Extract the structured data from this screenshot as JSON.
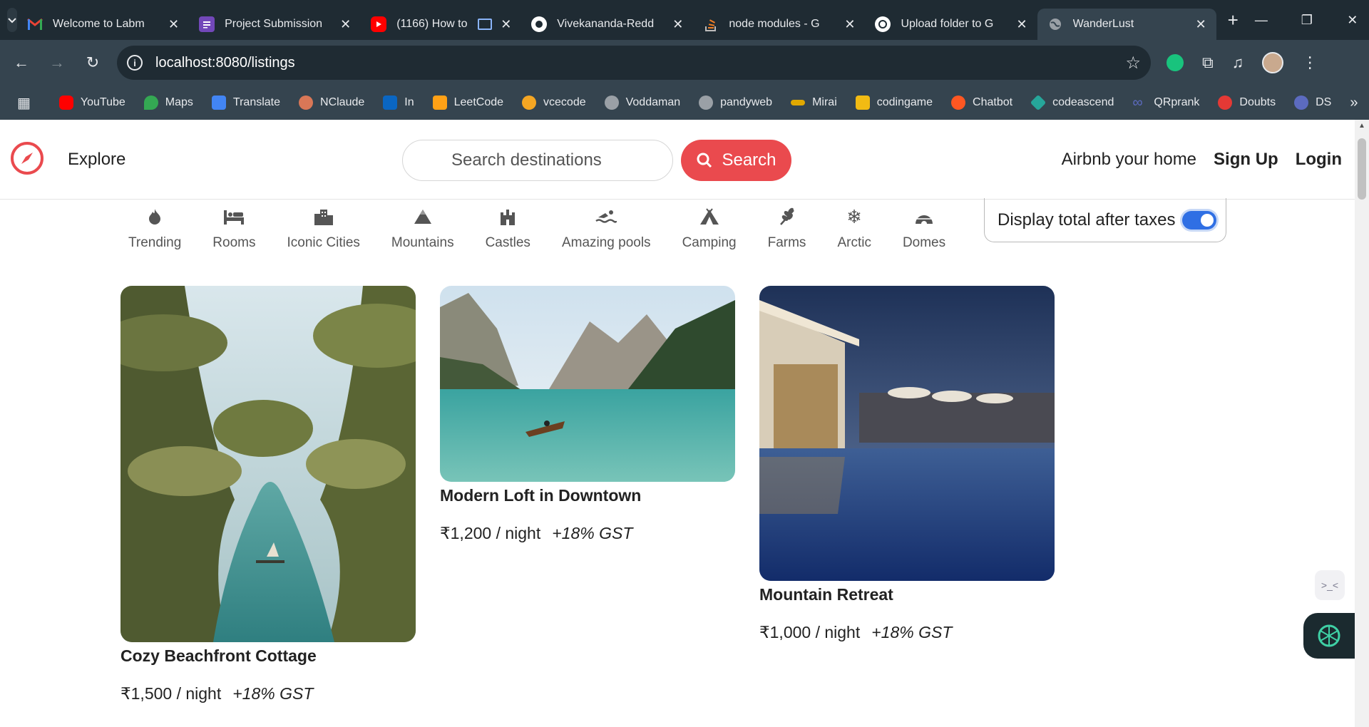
{
  "browser": {
    "tabs": [
      {
        "title": "Welcome to Labm",
        "favicon": "gmail-icon",
        "color": "#ea4335"
      },
      {
        "title": "Project Submission",
        "favicon": "forms-icon",
        "color": "#7248b9"
      },
      {
        "title": "(1166) How to",
        "favicon": "youtube-icon",
        "color": "#ff0000"
      },
      {
        "title": "Vivekananda-Redd",
        "favicon": "github-icon",
        "color": "#ffffff"
      },
      {
        "title": "node modules - G",
        "favicon": "stackoverflow-icon",
        "color": "#f48024"
      },
      {
        "title": "Upload folder to G",
        "favicon": "chatgpt-icon",
        "color": "#ffffff"
      },
      {
        "title": "WanderLust",
        "favicon": "globe-icon",
        "color": "#9aa0a6"
      }
    ],
    "url": "localhost:8080/listings",
    "bookmarks": [
      {
        "label": "YouTube",
        "color": "#ff0000"
      },
      {
        "label": "Maps",
        "color": "#34a853"
      },
      {
        "label": "Translate",
        "color": "#4285f4"
      },
      {
        "label": "NClaude",
        "color": "#d97757"
      },
      {
        "label": "In",
        "color": "#0a66c2"
      },
      {
        "label": "LeetCode",
        "color": "#ffa116"
      },
      {
        "label": "vcecode",
        "color": "#f5a623"
      },
      {
        "label": "Voddaman",
        "color": "#9aa0a6"
      },
      {
        "label": "pandyweb",
        "color": "#9aa0a6"
      },
      {
        "label": "Mirai",
        "color": "#e0a800"
      },
      {
        "label": "codingame",
        "color": "#f2bb13"
      },
      {
        "label": "Chatbot",
        "color": "#ff5722"
      },
      {
        "label": "codeascend",
        "color": "#26a69a"
      },
      {
        "label": "QRprank",
        "color": "#5c6bc0"
      },
      {
        "label": "Doubts",
        "color": "#e53935"
      },
      {
        "label": "DS",
        "color": "#5c6bc0"
      }
    ]
  },
  "site": {
    "explore": "Explore",
    "search_placeholder": "Search destinations",
    "search_label": "Search",
    "host_link": "Airbnb your home",
    "signup": "Sign Up",
    "login": "Login",
    "brand_color": "#ea4a4e"
  },
  "filters": [
    {
      "label": "Trending",
      "icon": "fire-icon"
    },
    {
      "label": "Rooms",
      "icon": "bed-icon"
    },
    {
      "label": "Iconic Cities",
      "icon": "city-icon"
    },
    {
      "label": "Mountains",
      "icon": "mountain-icon"
    },
    {
      "label": "Castles",
      "icon": "castle-icon"
    },
    {
      "label": "Amazing pools",
      "icon": "swimmer-icon"
    },
    {
      "label": "Camping",
      "icon": "tent-icon"
    },
    {
      "label": "Farms",
      "icon": "wheat-icon"
    },
    {
      "label": "Arctic",
      "icon": "snowflake-icon"
    },
    {
      "label": "Domes",
      "icon": "igloo-icon"
    }
  ],
  "tax_toggle": {
    "label": "Display total after taxes",
    "enabled": true
  },
  "listings": [
    {
      "title": "Cozy Beachfront Cottage",
      "price": "₹1,500 / night",
      "gst": "+18% GST",
      "image": "tropical-river-photo"
    },
    {
      "title": "Modern Loft in Downtown",
      "price": "₹1,200 / night",
      "gst": "+18% GST",
      "image": "mountain-lake-photo"
    },
    {
      "title": "Mountain Retreat",
      "price": "₹1,000 / night",
      "gst": "+18% GST",
      "image": "resort-pool-photo"
    }
  ]
}
